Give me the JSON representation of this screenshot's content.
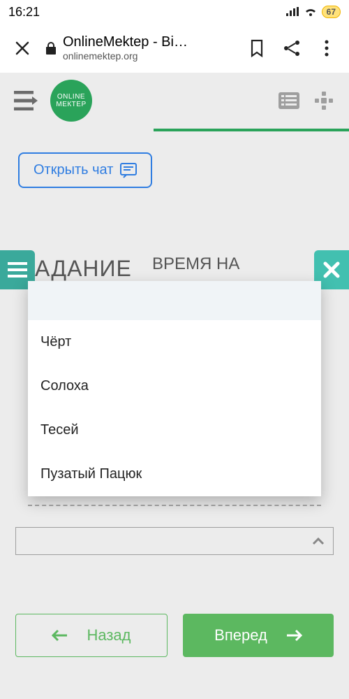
{
  "status": {
    "time": "16:21",
    "battery": "67"
  },
  "browser": {
    "title": "OnlineMektep - Bi…",
    "host": "onlinemektep.org"
  },
  "app": {
    "logo_line1": "ONLINE",
    "logo_line2": "МЕКТЕР"
  },
  "chat": {
    "label": "Открыть чат"
  },
  "heading": {
    "main": "АДАНИЕ",
    "sub": "ВРЕМЯ НА"
  },
  "dropdown": {
    "options": [
      "Чёрт",
      "Солоха",
      "Тесей",
      "Пузатый Пацюк"
    ]
  },
  "nav": {
    "back": "Назад",
    "forward": "Вперед"
  }
}
